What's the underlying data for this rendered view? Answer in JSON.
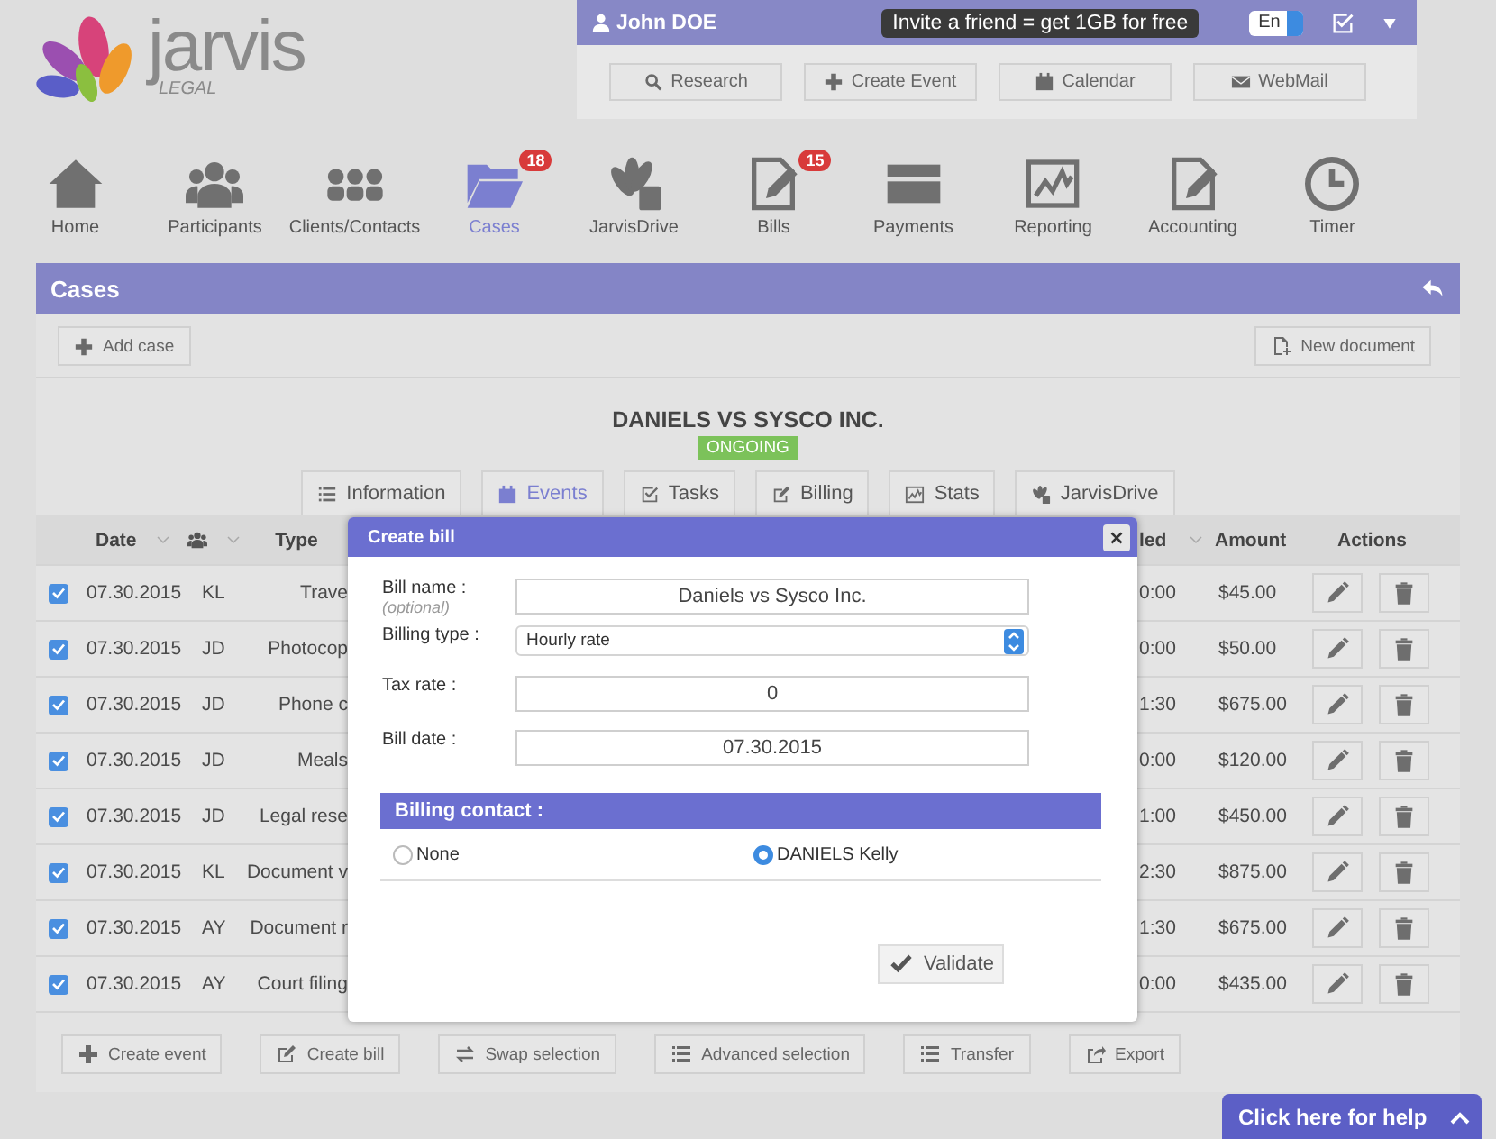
{
  "logo": {
    "name": "jarvis",
    "subtitle": "LEGAL"
  },
  "user_bar": {
    "user_name": "John DOE",
    "invite": "Invite a friend = get 1GB for free",
    "language": "En"
  },
  "toolbar": [
    {
      "label": "Research",
      "kind": "search"
    },
    {
      "label": "Create Event",
      "kind": "plus"
    },
    {
      "label": "Calendar",
      "kind": "calendar"
    },
    {
      "label": "WebMail",
      "kind": "mail"
    }
  ],
  "nav": [
    {
      "label": "Home",
      "kind": "home",
      "selected": false
    },
    {
      "label": "Participants",
      "kind": "people",
      "selected": false
    },
    {
      "label": "Clients/Contacts",
      "kind": "group",
      "selected": false
    },
    {
      "label": "Cases",
      "kind": "folder",
      "selected": true,
      "badge": "18"
    },
    {
      "label": "JarvisDrive",
      "kind": "drive",
      "selected": false
    },
    {
      "label": "Bills",
      "kind": "bill",
      "selected": false,
      "badge": "15"
    },
    {
      "label": "Payments",
      "kind": "card",
      "selected": false
    },
    {
      "label": "Reporting",
      "kind": "chart",
      "selected": false
    },
    {
      "label": "Accounting",
      "kind": "bill",
      "selected": false
    },
    {
      "label": "Timer",
      "kind": "clock",
      "selected": false
    }
  ],
  "section": {
    "title": "Cases",
    "add_button": "Add case",
    "new_document_button": "New document"
  },
  "case": {
    "title": "DANIELS VS SYSCO INC.",
    "status": "ONGOING"
  },
  "case_tabs": [
    {
      "label": "Information",
      "kind": "list",
      "selected": false
    },
    {
      "label": "Events",
      "kind": "calendar",
      "selected": true
    },
    {
      "label": "Tasks",
      "kind": "checkbox",
      "selected": false
    },
    {
      "label": "Billing",
      "kind": "edit",
      "selected": false
    },
    {
      "label": "Stats",
      "kind": "chart",
      "selected": false
    },
    {
      "label": "JarvisDrive",
      "kind": "drive",
      "selected": false
    }
  ],
  "table": {
    "columns": [
      {
        "label": "Date",
        "kind": "text",
        "sortable": true
      },
      {
        "kind": "people",
        "sortable": true
      },
      {
        "label": "Type",
        "kind": "text",
        "sortable": false
      },
      {
        "label": "led",
        "kind": "text",
        "sortable": true
      },
      {
        "label": "Amount",
        "kind": "text",
        "sortable": false
      },
      {
        "label": "Actions",
        "kind": "text",
        "sortable": false
      }
    ],
    "rows": [
      {
        "checked": true,
        "date": "07.30.2015",
        "initials": "KL",
        "type": "Trave",
        "time": "0:00",
        "amount": "$45.00"
      },
      {
        "checked": true,
        "date": "07.30.2015",
        "initials": "JD",
        "type": "Photocop",
        "time": "0:00",
        "amount": "$50.00"
      },
      {
        "checked": true,
        "date": "07.30.2015",
        "initials": "JD",
        "type": "Phone c",
        "time": "1:30",
        "amount": "$675.00"
      },
      {
        "checked": true,
        "date": "07.30.2015",
        "initials": "JD",
        "type": "Meals",
        "time": "0:00",
        "amount": "$120.00"
      },
      {
        "checked": true,
        "date": "07.30.2015",
        "initials": "JD",
        "type": "Legal rese",
        "time": "1:00",
        "amount": "$450.00"
      },
      {
        "checked": true,
        "date": "07.30.2015",
        "initials": "KL",
        "type": "Document v",
        "time": "2:30",
        "amount": "$875.00"
      },
      {
        "checked": true,
        "date": "07.30.2015",
        "initials": "AY",
        "type": "Document r",
        "time": "1:30",
        "amount": "$675.00"
      },
      {
        "checked": true,
        "date": "07.30.2015",
        "initials": "AY",
        "type": "Court filing",
        "time": "0:00",
        "amount": "$435.00"
      }
    ]
  },
  "footer_buttons": [
    {
      "label": "Create event",
      "kind": "plus"
    },
    {
      "label": "Create bill",
      "kind": "editbox"
    },
    {
      "label": "Swap selection",
      "kind": "swap"
    },
    {
      "label": "Advanced selection",
      "kind": "list"
    },
    {
      "label": "Transfer",
      "kind": "list"
    },
    {
      "label": "Export",
      "kind": "export"
    }
  ],
  "help": {
    "label": "Click here for help"
  },
  "modal": {
    "title": "Create bill",
    "fields": [
      {
        "label": "Bill name :",
        "hint": "(optional)",
        "kind": "text",
        "value": "Daniels vs Sysco Inc."
      },
      {
        "label": "Billing type :",
        "kind": "select",
        "value": "Hourly rate"
      },
      {
        "label": "Tax rate :",
        "kind": "text",
        "value": "0"
      },
      {
        "label": "Bill date :",
        "kind": "text",
        "value": "07.30.2015"
      }
    ],
    "billing_contact": {
      "title": "Billing contact :",
      "options": [
        {
          "label": "None",
          "selected": false
        },
        {
          "label": "DANIELS Kelly",
          "selected": true
        }
      ]
    },
    "validate_button": "Validate"
  }
}
